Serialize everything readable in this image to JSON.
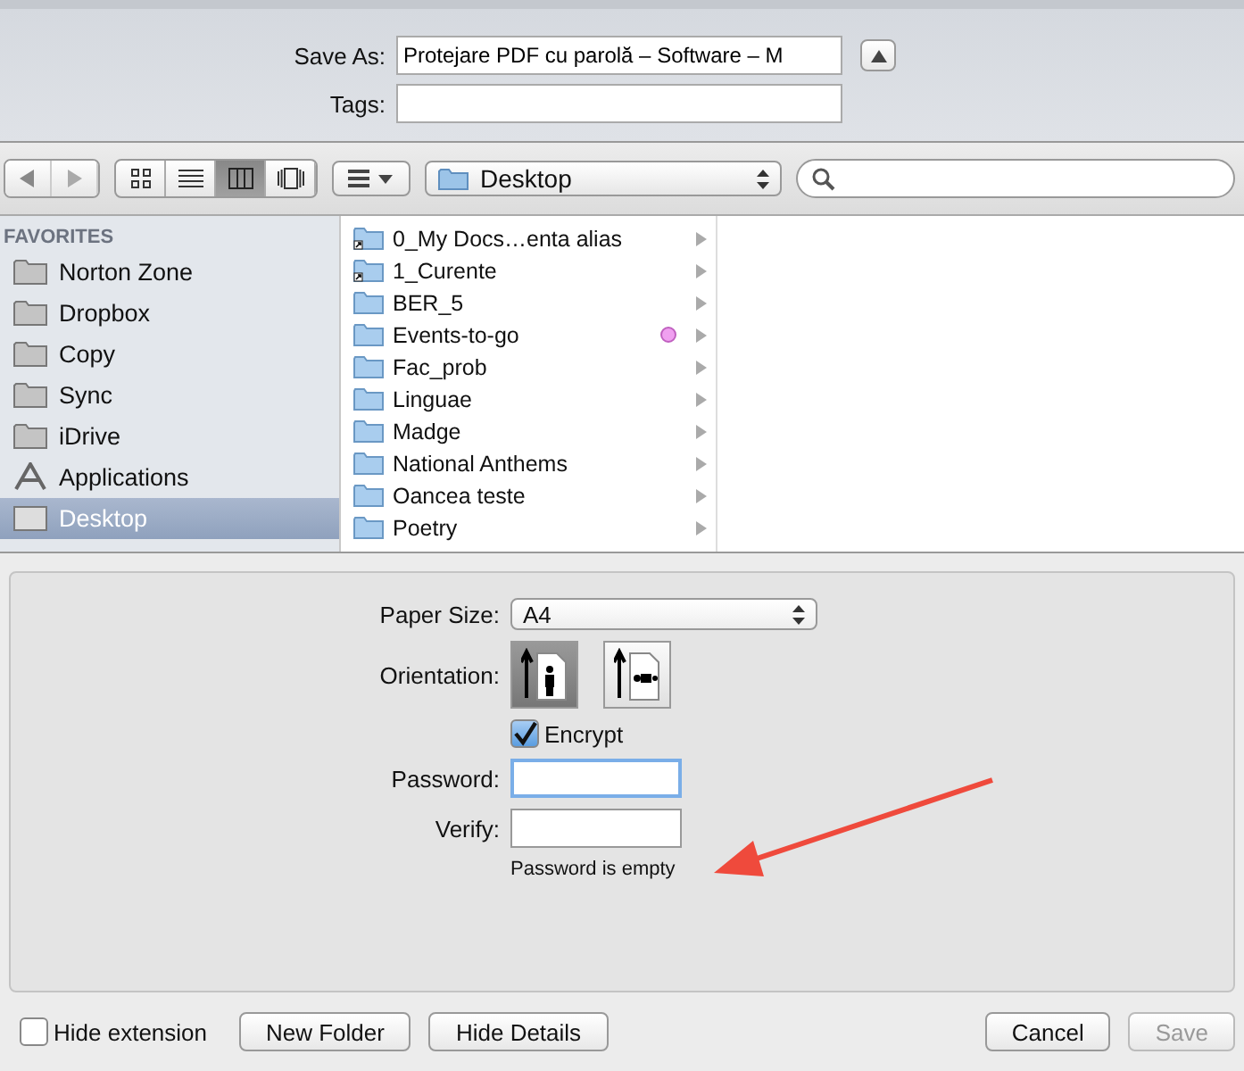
{
  "save_as": {
    "label": "Save As:",
    "value": "Protejare PDF cu parolă – Software – M"
  },
  "tags": {
    "label": "Tags:"
  },
  "toolbar": {
    "views": [
      {
        "kind": "icons",
        "selected": false
      },
      {
        "kind": "list",
        "selected": false
      },
      {
        "kind": "columns",
        "selected": true
      },
      {
        "kind": "coverflow",
        "selected": false
      }
    ],
    "location": "Desktop"
  },
  "sidebar": {
    "heading": "FAVORITES",
    "items": [
      {
        "label": "Norton Zone",
        "kind": "folder",
        "selected": false
      },
      {
        "label": "Dropbox",
        "kind": "folder",
        "selected": false
      },
      {
        "label": "Copy",
        "kind": "folder",
        "selected": false
      },
      {
        "label": "Sync",
        "kind": "folder",
        "selected": false
      },
      {
        "label": "iDrive",
        "kind": "folder",
        "selected": false
      },
      {
        "label": "Applications",
        "kind": "apps",
        "selected": false
      },
      {
        "label": "Desktop",
        "kind": "desktop",
        "selected": true
      }
    ]
  },
  "files": [
    {
      "name": "0_My Docs…enta alias",
      "kind": "alias"
    },
    {
      "name": "1_Curente",
      "kind": "alias"
    },
    {
      "name": "BER_5",
      "kind": "folder"
    },
    {
      "name": "Events-to-go",
      "kind": "folder",
      "color": "#f0a0f0"
    },
    {
      "name": "Fac_prob",
      "kind": "folder"
    },
    {
      "name": "Linguae",
      "kind": "folder"
    },
    {
      "name": "Madge",
      "kind": "folder"
    },
    {
      "name": "National Anthems",
      "kind": "folder"
    },
    {
      "name": "Oancea teste",
      "kind": "folder"
    },
    {
      "name": "Poetry",
      "kind": "folder"
    }
  ],
  "options": {
    "paper_size": {
      "label": "Paper Size:",
      "value": "A4"
    },
    "orientation": {
      "label": "Orientation:",
      "items": [
        {
          "kind": "portrait",
          "selected": true
        },
        {
          "kind": "landscape",
          "selected": false
        }
      ]
    },
    "encrypt": {
      "label": "Encrypt",
      "checked": true
    },
    "password": {
      "label": "Password:"
    },
    "verify": {
      "label": "Verify:"
    },
    "message": "Password is empty"
  },
  "hide_extension": {
    "label": "Hide extension",
    "checked": false
  },
  "buttons": {
    "new_folder": "New Folder",
    "hide_details": "Hide Details",
    "cancel": "Cancel",
    "save": {
      "label": "Save",
      "disabled": true
    }
  }
}
